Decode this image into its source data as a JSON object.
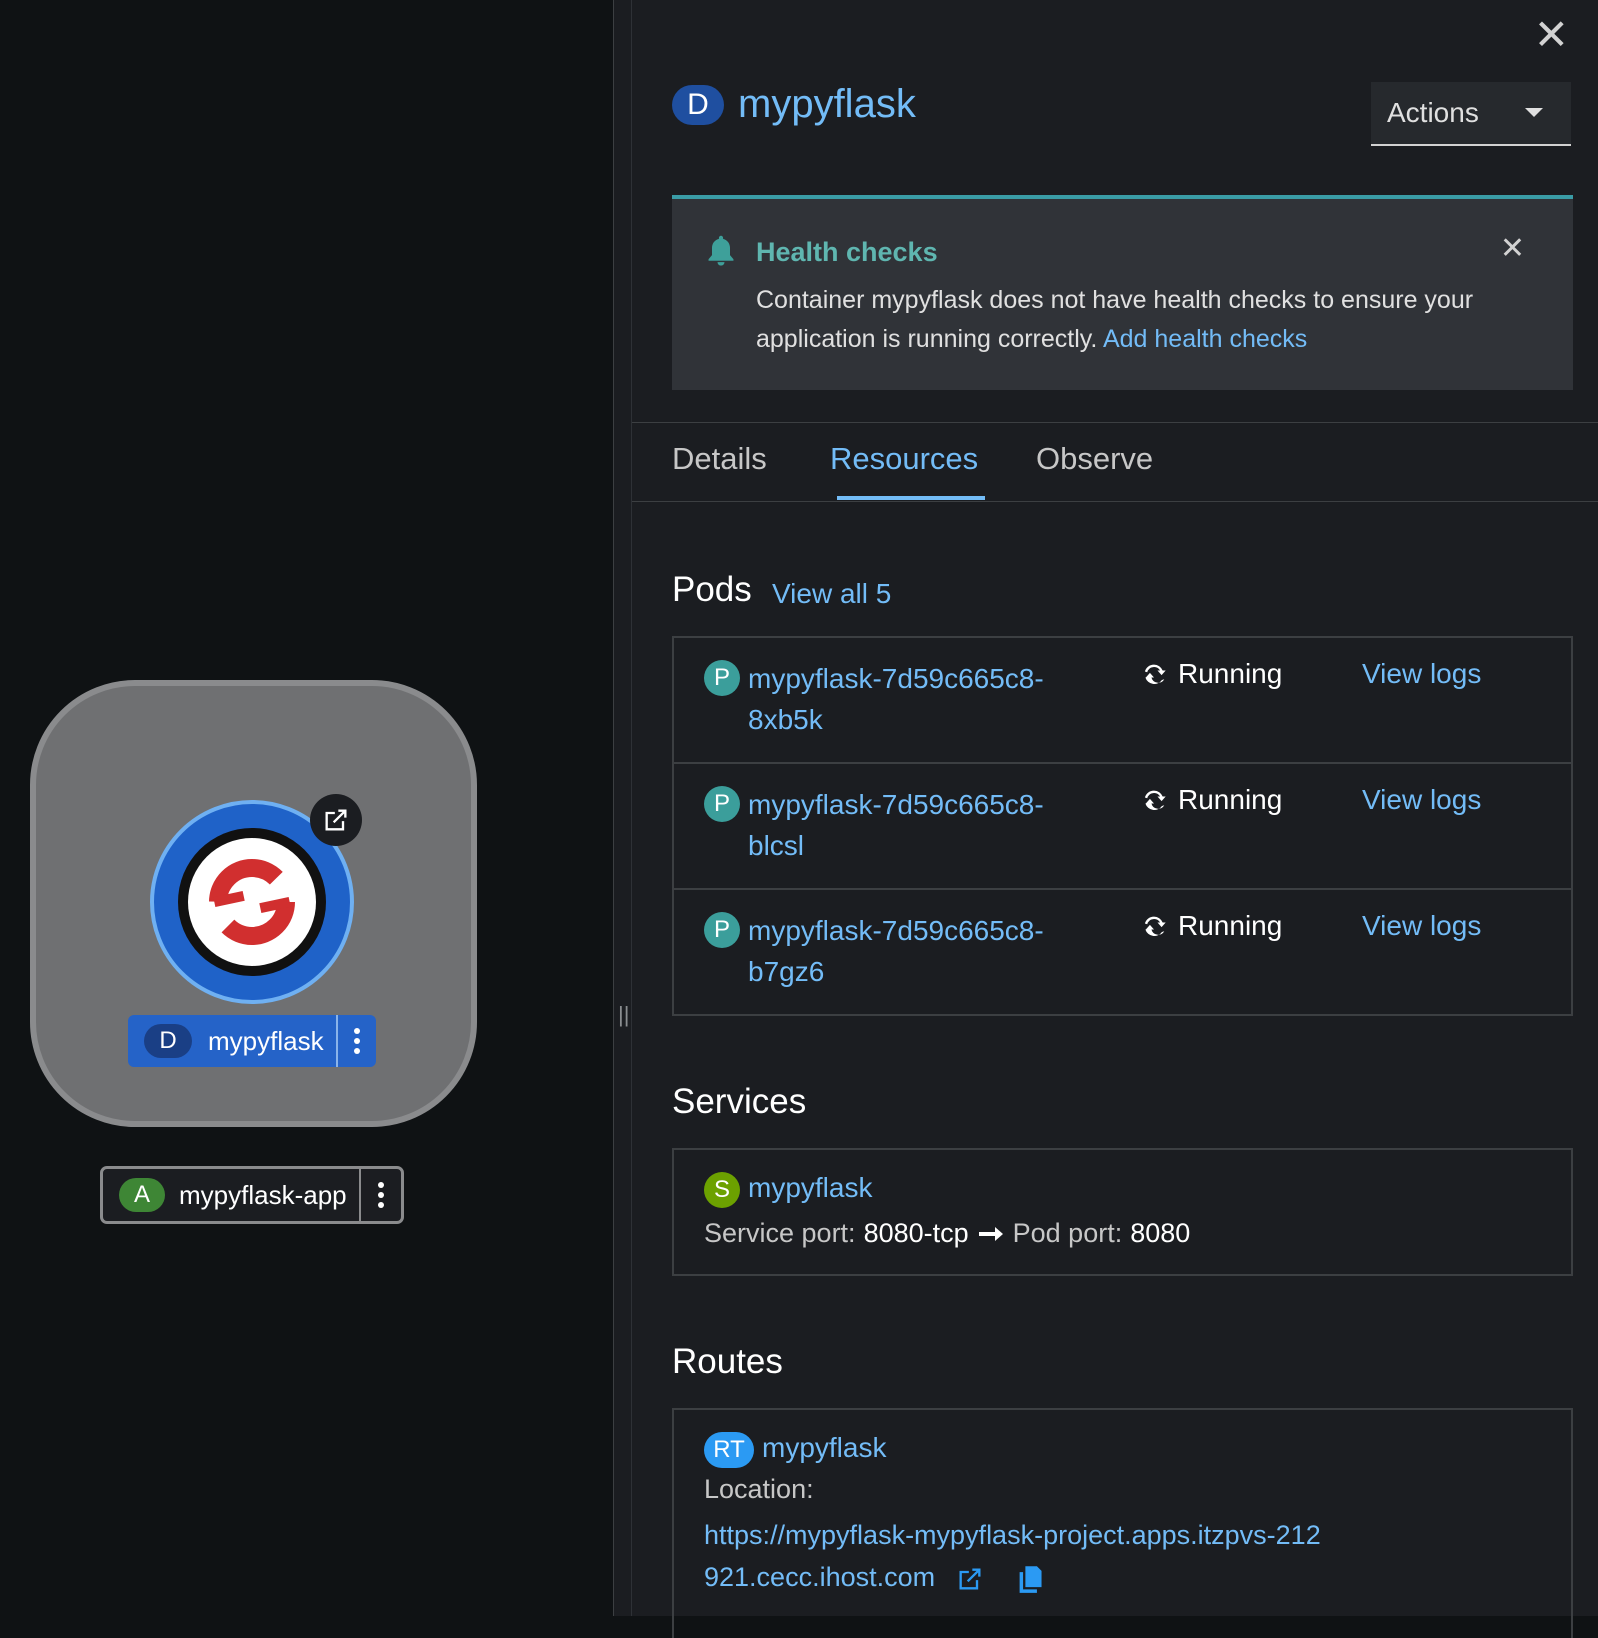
{
  "topology": {
    "node": {
      "kind_badge": "D",
      "name": "mypyflask"
    },
    "application": {
      "kind_badge": "A",
      "name": "mypyflask-app"
    }
  },
  "panel": {
    "kind_badge": "D",
    "title": "mypyflask",
    "actions_label": "Actions",
    "alert": {
      "title": "Health checks",
      "body": "Container mypyflask does not have health checks to ensure your application is running correctly.",
      "link": "Add health checks"
    },
    "tabs": [
      "Details",
      "Resources",
      "Observe"
    ],
    "active_tab": "Resources",
    "pods": {
      "title": "Pods",
      "view_all": "View all 5",
      "items": [
        {
          "badge": "P",
          "name": "mypyflask-7d59c665c8-8xb5k",
          "status": "Running",
          "logs": "View logs"
        },
        {
          "badge": "P",
          "name": "mypyflask-7d59c665c8-blcsl",
          "status": "Running",
          "logs": "View logs"
        },
        {
          "badge": "P",
          "name": "mypyflask-7d59c665c8-b7gz6",
          "status": "Running",
          "logs": "View logs"
        }
      ]
    },
    "services": {
      "title": "Services",
      "badge": "S",
      "name": "mypyflask",
      "service_port_label": "Service port:",
      "service_port": "8080-tcp",
      "pod_port_label": "Pod port:",
      "pod_port": "8080"
    },
    "routes": {
      "title": "Routes",
      "badge": "RT",
      "name": "mypyflask",
      "location_label": "Location:",
      "url": "https://mypyflask-mypyflask-project.apps.itzpvs-212921.cecc.ihost.com"
    }
  },
  "colors": {
    "link": "#73bcf7",
    "accent_teal": "#3a9ca6",
    "pod_badge": "#3b9e9b",
    "service_badge": "#6ca100",
    "route_badge": "#2b9af3",
    "app_badge": "#3e8635",
    "deployment_badge": "#1f4fa0"
  },
  "icons": [
    "close-icon",
    "caret-down-icon",
    "bell-icon",
    "sync-icon",
    "right-arrow-icon",
    "external-link-icon",
    "copy-icon",
    "kebab-icon",
    "openshift-logo-icon",
    "drag-handle-icon"
  ]
}
